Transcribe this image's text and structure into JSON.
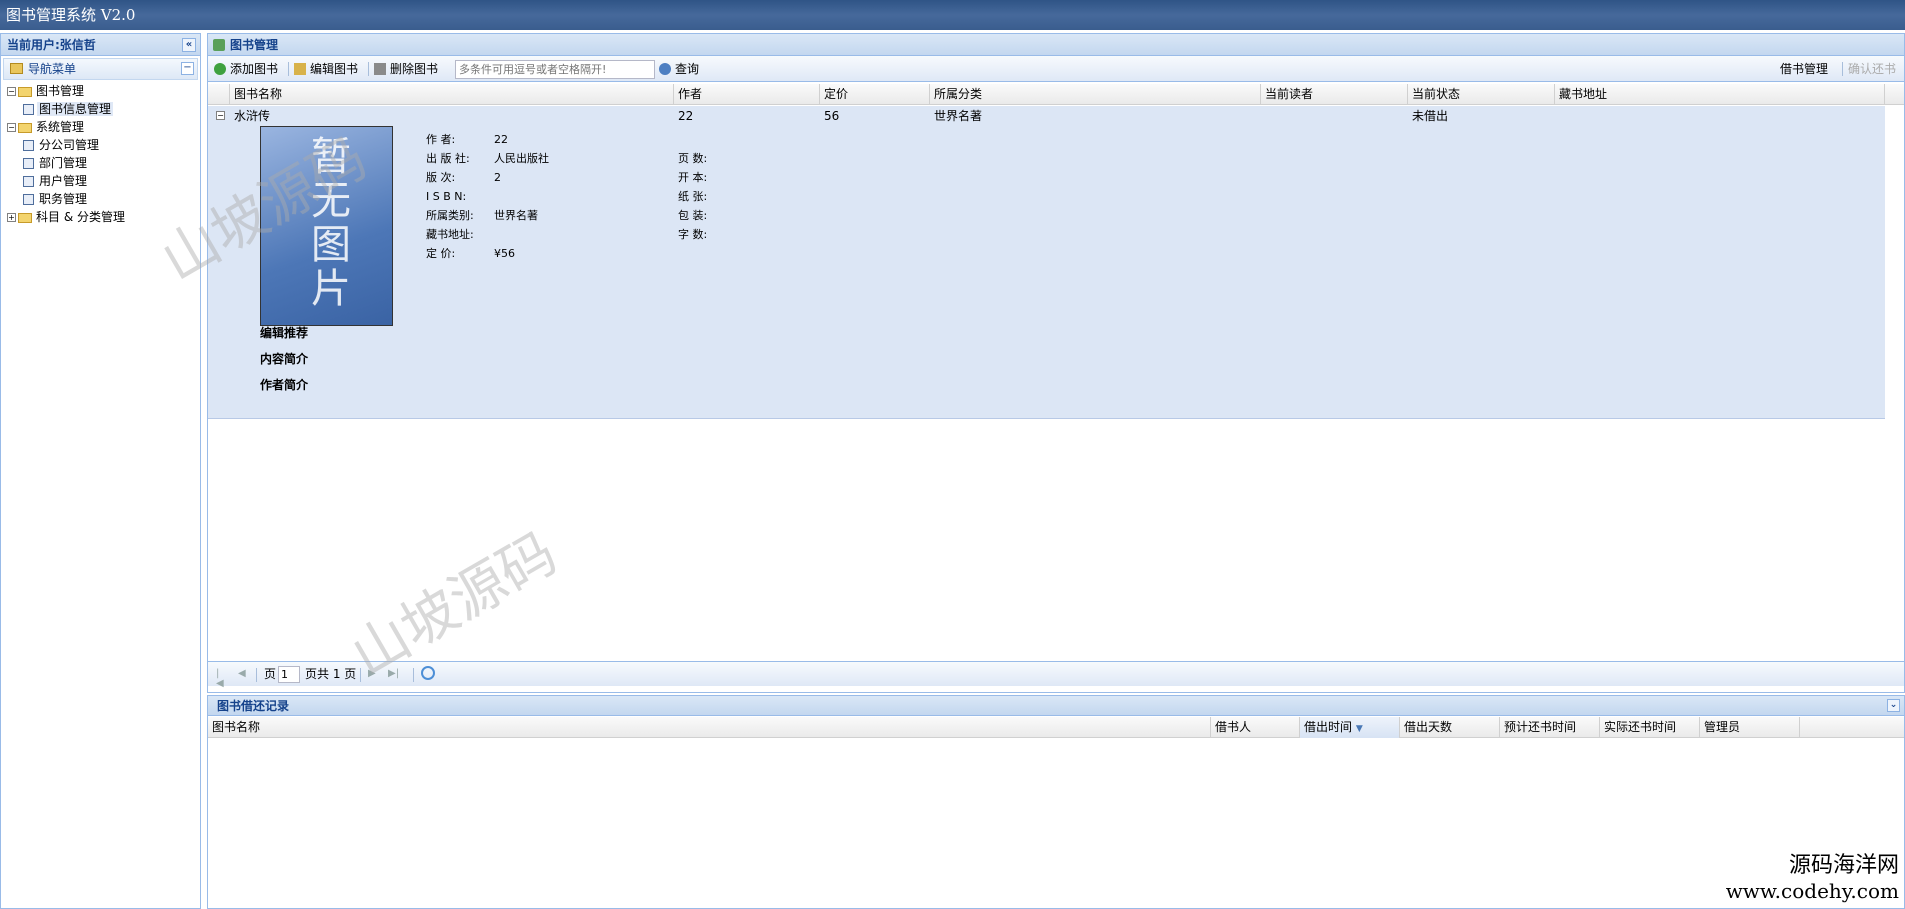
{
  "app": {
    "title": "图书管理系统 V2.0"
  },
  "left": {
    "header": "当前用户:张信哲",
    "collapse_icon": "«",
    "nav_title": "导航菜单",
    "tree": [
      {
        "label": "图书管理",
        "type": "folder",
        "expanded": true
      },
      {
        "label": "图书信息管理",
        "type": "leaf",
        "selected": true
      },
      {
        "label": "系统管理",
        "type": "folder",
        "expanded": true
      },
      {
        "label": "分公司管理",
        "type": "leaf"
      },
      {
        "label": "部门管理",
        "type": "leaf"
      },
      {
        "label": "用户管理",
        "type": "leaf"
      },
      {
        "label": "职务管理",
        "type": "leaf"
      },
      {
        "label": "科目 & 分类管理",
        "type": "folder",
        "expanded": false
      }
    ]
  },
  "main": {
    "title": "图书管理",
    "toolbar": {
      "add": "添加图书",
      "edit": "编辑图书",
      "delete": "删除图书",
      "search_placeholder": "多条件可用逗号或者空格隔开!",
      "search": "查询",
      "borrow": "借书管理",
      "return": "确认还书"
    },
    "columns": [
      "图书名称",
      "作者",
      "定价",
      "所属分类",
      "当前读者",
      "当前状态",
      "藏书地址"
    ],
    "row": {
      "name": "水浒传",
      "author": "22",
      "price": "56",
      "category": "世界名著",
      "reader": "",
      "status": "未借出",
      "location": ""
    },
    "cover_text": "暂无图片",
    "detail_left": [
      {
        "k": "作    者:",
        "v": "22"
      },
      {
        "k": "出 版 社:",
        "v": "人民出版社"
      },
      {
        "k": "版    次:",
        "v": "2"
      },
      {
        "k": "I S B N:",
        "v": ""
      },
      {
        "k": "所属类别:",
        "v": "世界名著"
      },
      {
        "k": "藏书地址:",
        "v": ""
      },
      {
        "k": "定    价:",
        "v": "¥56"
      }
    ],
    "detail_right": [
      {
        "k": "页    数:",
        "v": ""
      },
      {
        "k": "开    本:",
        "v": ""
      },
      {
        "k": "纸    张:",
        "v": ""
      },
      {
        "k": "包    装:",
        "v": ""
      },
      {
        "k": "字    数:",
        "v": ""
      }
    ],
    "detail_links": [
      "编辑推荐",
      "内容简介",
      "作者简介"
    ],
    "pager": {
      "page_label": "页",
      "page_value": "1",
      "total": "页共 1 页"
    }
  },
  "bottom": {
    "title": "图书借还记录",
    "columns": [
      "图书名称",
      "借书人",
      "借出时间",
      "借出天数",
      "预计还书时间",
      "实际还书时间",
      "管理员"
    ]
  },
  "watermark": "山坡源码",
  "brand": {
    "line1": "源码海洋网",
    "line2": "www.codehy.com"
  }
}
